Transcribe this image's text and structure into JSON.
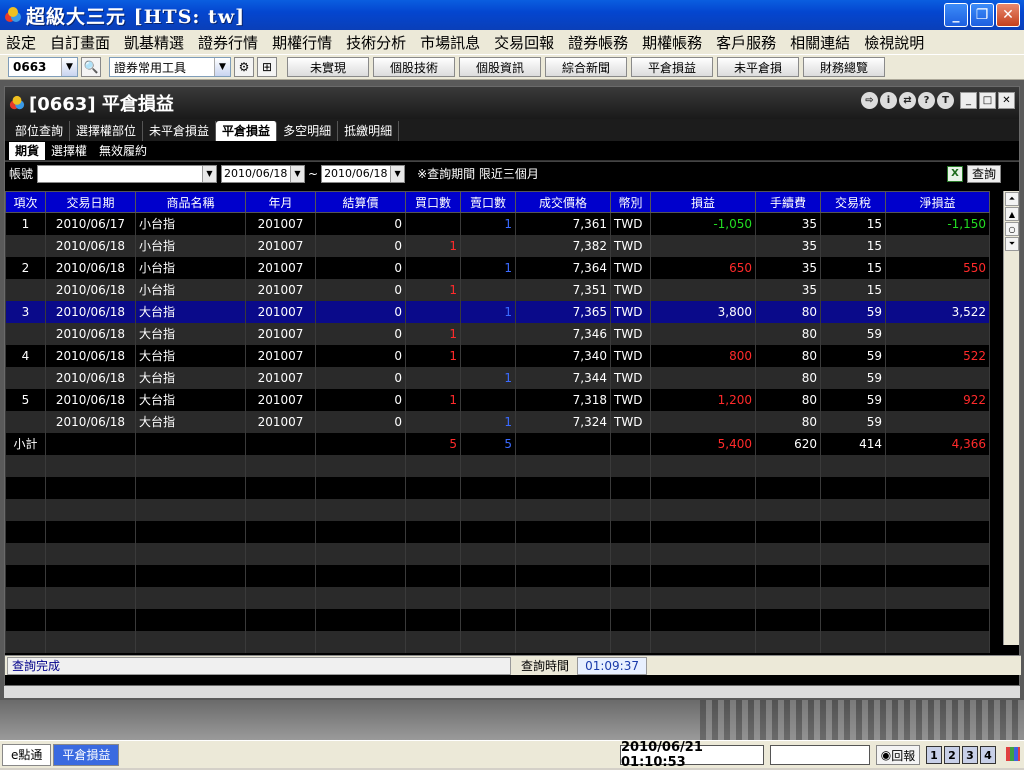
{
  "app": {
    "title": "超級大三元  [HTS: tw]"
  },
  "menu": [
    "設定",
    "自訂畫面",
    "凱基精選",
    "證券行情",
    "期權行情",
    "技術分析",
    "市場訊息",
    "交易回報",
    "證券帳務",
    "期權帳務",
    "客戶服務",
    "相關連結",
    "檢視說明"
  ],
  "toolbar": {
    "stock_code": "0663",
    "tool_select": "證券常用工具",
    "buttons": [
      "未實現",
      "個股技術",
      "個股資訊",
      "綜合新聞",
      "平倉損益",
      "未平倉損",
      "財務總覽"
    ]
  },
  "window": {
    "title": "[0663] 平倉損益",
    "icons": [
      "exit-icon",
      "info-icon",
      "share-icon",
      "help-icon",
      "text-icon"
    ],
    "tabs": [
      {
        "label": "部位查詢",
        "active": false
      },
      {
        "label": "選擇權部位",
        "active": false
      },
      {
        "label": "未平倉損益",
        "active": false
      },
      {
        "label": "平倉損益",
        "active": true
      },
      {
        "label": "多空明細",
        "active": false
      },
      {
        "label": "抵繳明細",
        "active": false
      }
    ],
    "subtabs": [
      {
        "label": "期貨",
        "active": true
      },
      {
        "label": "選擇權",
        "active": false
      },
      {
        "label": "無效履約",
        "active": false
      }
    ]
  },
  "filter": {
    "account_label": "帳號",
    "account_value": "",
    "date_from": "2010/06/18",
    "separator": "~",
    "date_to": "2010/06/18",
    "note": "※查詢期間 限近三個月",
    "query_button": "查詢"
  },
  "table": {
    "headers": [
      "項次",
      "交易日期",
      "商品名稱",
      "年月",
      "結算價",
      "買口數",
      "賣口數",
      "成交價格",
      "幣別",
      "損益",
      "手續費",
      "交易稅",
      "淨損益"
    ],
    "rows": [
      {
        "no": "1",
        "date": "2010/06/17",
        "name": "小台指",
        "ym": "201007",
        "settle": "0",
        "buy": "",
        "sell": "1",
        "price": "7,361",
        "cur": "TWD",
        "pl": "-1,050",
        "fee": "35",
        "tax": "15",
        "net": "-1,150"
      },
      {
        "no": "",
        "date": "2010/06/18",
        "name": "小台指",
        "ym": "201007",
        "settle": "0",
        "buy": "1",
        "sell": "",
        "price": "7,382",
        "cur": "TWD",
        "pl": "",
        "fee": "35",
        "tax": "15",
        "net": ""
      },
      {
        "no": "2",
        "date": "2010/06/18",
        "name": "小台指",
        "ym": "201007",
        "settle": "0",
        "buy": "",
        "sell": "1",
        "price": "7,364",
        "cur": "TWD",
        "pl": "650",
        "fee": "35",
        "tax": "15",
        "net": "550"
      },
      {
        "no": "",
        "date": "2010/06/18",
        "name": "小台指",
        "ym": "201007",
        "settle": "0",
        "buy": "1",
        "sell": "",
        "price": "7,351",
        "cur": "TWD",
        "pl": "",
        "fee": "35",
        "tax": "15",
        "net": ""
      },
      {
        "no": "3",
        "date": "2010/06/18",
        "name": "大台指",
        "ym": "201007",
        "settle": "0",
        "buy": "",
        "sell": "1",
        "price": "7,365",
        "cur": "TWD",
        "pl": "3,800",
        "fee": "80",
        "tax": "59",
        "net": "3,522",
        "selected": true
      },
      {
        "no": "",
        "date": "2010/06/18",
        "name": "大台指",
        "ym": "201007",
        "settle": "0",
        "buy": "1",
        "sell": "",
        "price": "7,346",
        "cur": "TWD",
        "pl": "",
        "fee": "80",
        "tax": "59",
        "net": ""
      },
      {
        "no": "4",
        "date": "2010/06/18",
        "name": "大台指",
        "ym": "201007",
        "settle": "0",
        "buy": "1",
        "sell": "",
        "price": "7,340",
        "cur": "TWD",
        "pl": "800",
        "fee": "80",
        "tax": "59",
        "net": "522"
      },
      {
        "no": "",
        "date": "2010/06/18",
        "name": "大台指",
        "ym": "201007",
        "settle": "0",
        "buy": "",
        "sell": "1",
        "price": "7,344",
        "cur": "TWD",
        "pl": "",
        "fee": "80",
        "tax": "59",
        "net": ""
      },
      {
        "no": "5",
        "date": "2010/06/18",
        "name": "大台指",
        "ym": "201007",
        "settle": "0",
        "buy": "1",
        "sell": "",
        "price": "7,318",
        "cur": "TWD",
        "pl": "1,200",
        "fee": "80",
        "tax": "59",
        "net": "922"
      },
      {
        "no": "",
        "date": "2010/06/18",
        "name": "大台指",
        "ym": "201007",
        "settle": "0",
        "buy": "",
        "sell": "1",
        "price": "7,324",
        "cur": "TWD",
        "pl": "",
        "fee": "80",
        "tax": "59",
        "net": ""
      }
    ],
    "subtotal": {
      "label": "小計",
      "buy": "5",
      "sell": "5",
      "pl": "5,400",
      "fee": "620",
      "tax": "414",
      "net": "4,366"
    },
    "empty_rows": 9
  },
  "status": {
    "message": "查詢完成",
    "time_label": "查詢時間",
    "time_value": "01:09:37"
  },
  "taskbar": {
    "tabs": [
      {
        "label": "e點通",
        "active": false
      },
      {
        "label": "平倉損益",
        "active": true
      }
    ],
    "clock": "2010/06/21 01:10:53",
    "report_button": "回報",
    "nums": [
      "1",
      "2",
      "3",
      "4"
    ]
  },
  "colors": {
    "header_blue": "#0000cc",
    "loss_green": "#22dd22",
    "profit_red": "#ff2a2a",
    "buy_red": "#ff2a2a",
    "sell_blue": "#3a6aff",
    "selected_row": "#0a0a8a"
  }
}
